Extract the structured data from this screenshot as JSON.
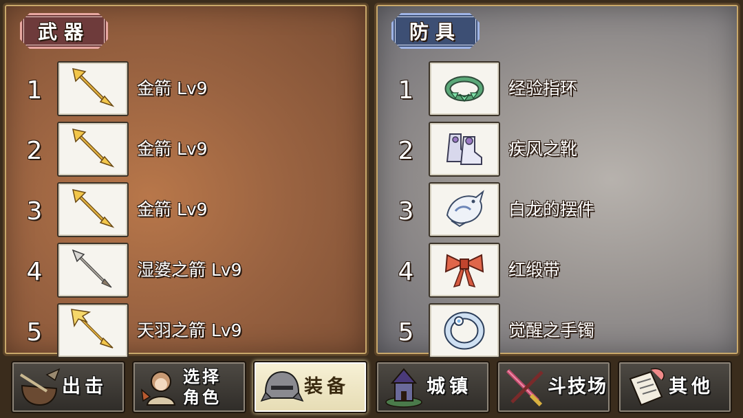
{
  "weapons": {
    "title": "武器",
    "items": [
      {
        "index": "1",
        "name": "金箭 Lv9",
        "icon": "gold-arrow-icon"
      },
      {
        "index": "2",
        "name": "金箭 Lv9",
        "icon": "gold-arrow-icon"
      },
      {
        "index": "3",
        "name": "金箭 Lv9",
        "icon": "gold-arrow-icon"
      },
      {
        "index": "4",
        "name": "湿婆之箭 Lv9",
        "icon": "shiva-arrow-icon"
      },
      {
        "index": "5",
        "name": "天羽之箭 Lv9",
        "icon": "feather-arrow-icon"
      }
    ]
  },
  "armor": {
    "title": "防具",
    "items": [
      {
        "index": "1",
        "name": "经验指环",
        "icon": "exp-ring-icon"
      },
      {
        "index": "2",
        "name": "疾风之靴",
        "icon": "wind-boots-icon"
      },
      {
        "index": "3",
        "name": "白龙的摆件",
        "icon": "white-dragon-ornament-icon"
      },
      {
        "index": "4",
        "name": "红缎带",
        "icon": "red-ribbon-icon"
      },
      {
        "index": "5",
        "name": "觉醒之手镯",
        "icon": "awakening-bracelet-icon"
      }
    ]
  },
  "nav": {
    "sortie": "出击",
    "select_1": "选择",
    "select_2": "角色",
    "equip": "装备",
    "town": "城镇",
    "arena": "斗技场",
    "other": "其他",
    "active": "equip"
  },
  "colors": {
    "weapon_bg": "#9a6341",
    "armor_bg": "#9a9592",
    "weapon_tag": "#6e3b3b",
    "armor_tag": "#3d4f74",
    "active_nav": "#f0e8c8"
  }
}
